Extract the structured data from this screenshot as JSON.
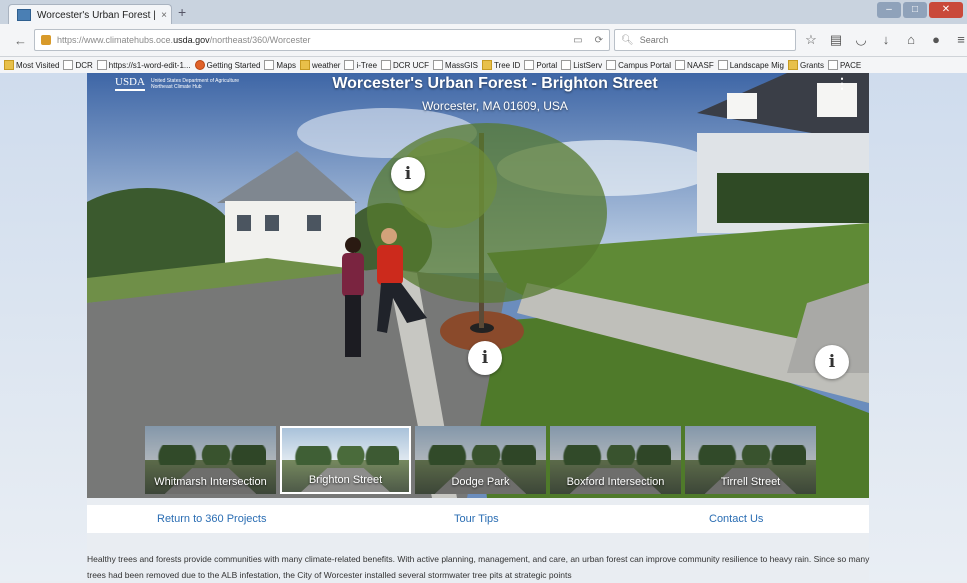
{
  "browser": {
    "tab_title": "Worcester's Urban Forest | ...",
    "tab_close": "×",
    "new_tab": "+",
    "url_prefix": "https://www.climatehubs.oce.",
    "url_domain": "usda.gov",
    "url_suffix": "/northeast/360/Worcester",
    "search_placeholder": "Search",
    "bookmarks": [
      {
        "label": "Most Visited",
        "icon": "folder"
      },
      {
        "label": "DCR",
        "icon": "page"
      },
      {
        "label": "https://s1-word-edit-1...",
        "icon": "page"
      },
      {
        "label": "Getting Started",
        "icon": "firefox"
      },
      {
        "label": "Maps",
        "icon": "page"
      },
      {
        "label": "weather",
        "icon": "folder"
      },
      {
        "label": "i-Tree",
        "icon": "page"
      },
      {
        "label": "DCR UCF",
        "icon": "page"
      },
      {
        "label": "MassGIS",
        "icon": "page"
      },
      {
        "label": "Tree ID",
        "icon": "folder"
      },
      {
        "label": "Portal",
        "icon": "page"
      },
      {
        "label": "ListServ",
        "icon": "page"
      },
      {
        "label": "Campus Portal",
        "icon": "page"
      },
      {
        "label": "NAASF",
        "icon": "page"
      },
      {
        "label": "Landscape Mig",
        "icon": "page"
      },
      {
        "label": "Grants",
        "icon": "folder"
      },
      {
        "label": "PACE",
        "icon": "page"
      }
    ]
  },
  "pano": {
    "logo": "USDA",
    "logo_text_1": "United States Department of Agriculture",
    "logo_text_2": "Northeast Climate Hub",
    "title": "Worcester's Urban Forest - Brighton Street",
    "subtitle": "Worcester, MA 01609, USA",
    "menu": "⋮",
    "hotspot_glyph": "i",
    "thumbnails": [
      {
        "label": "Whitmarsh Intersection",
        "active": false
      },
      {
        "label": "Brighton Street",
        "active": true
      },
      {
        "label": "Dodge Park",
        "active": false
      },
      {
        "label": "Boxford Intersection",
        "active": false
      },
      {
        "label": "Tirrell Street",
        "active": false
      }
    ]
  },
  "links": {
    "return": "Return to 360 Projects",
    "tips": "Tour Tips",
    "contact": "Contact Us"
  },
  "body_text": "Healthy trees and forests provide communities with many climate-related benefits. With active planning, management, and care, an urban forest can improve community resilience to heavy rain. Since so many trees had been removed due to the ALB infestation, the City of Worcester installed several stormwater tree pits at strategic points",
  "colors": {
    "link": "#2a6db3"
  }
}
